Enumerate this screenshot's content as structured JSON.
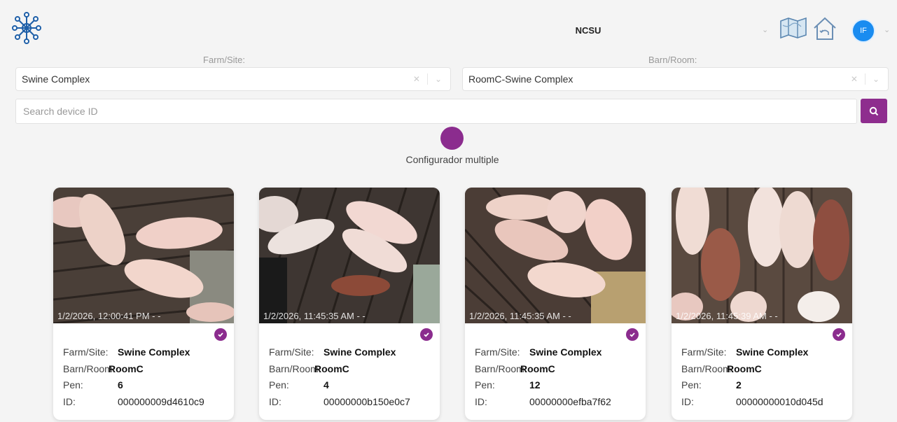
{
  "header": {
    "title": "NCSU",
    "user_initials": "IF",
    "logo_icon": "network-logo",
    "icons": [
      "chevron-down-icon",
      "map-icon",
      "home-icon"
    ]
  },
  "filters": {
    "farm_label": "Farm/Site:",
    "farm_value": "Swine Complex",
    "barn_label": "Barn/Room:",
    "barn_value": "RoomC-Swine Complex"
  },
  "search": {
    "placeholder": "Search device ID"
  },
  "multi": {
    "label": "Configurador multiple"
  },
  "cards": [
    {
      "timestamp": "1/2/2026, 12:00:41 PM - -",
      "farm_key": "Farm/Site:",
      "farm": "Swine Complex",
      "barn_key": "Barn/Room:",
      "barn": "RoomC",
      "pen_key": "Pen:",
      "pen": "6",
      "id_key": "ID:",
      "id": "000000009d4610c9"
    },
    {
      "timestamp": "1/2/2026, 11:45:35 AM - -",
      "farm_key": "Farm/Site:",
      "farm": "Swine Complex",
      "barn_key": "Barn/Room:",
      "barn": "RoomC",
      "pen_key": "Pen:",
      "pen": "4",
      "id_key": "ID:",
      "id": "00000000b150e0c7"
    },
    {
      "timestamp": "1/2/2026, 11:45:35 AM - -",
      "farm_key": "Farm/Site:",
      "farm": "Swine Complex",
      "barn_key": "Barn/Room:",
      "barn": "RoomC",
      "pen_key": "Pen:",
      "pen": "12",
      "id_key": "ID:",
      "id": "00000000efba7f62"
    },
    {
      "timestamp": "1/2/2026, 11:45:39 AM - -",
      "farm_key": "Farm/Site:",
      "farm": "Swine Complex",
      "barn_key": "Barn/Room:",
      "barn": "RoomC",
      "pen_key": "Pen:",
      "pen": "2",
      "id_key": "ID:",
      "id": "00000000010d045d"
    }
  ],
  "colors": {
    "accent": "#8b2c8e",
    "avatar": "#1a8cf0"
  }
}
